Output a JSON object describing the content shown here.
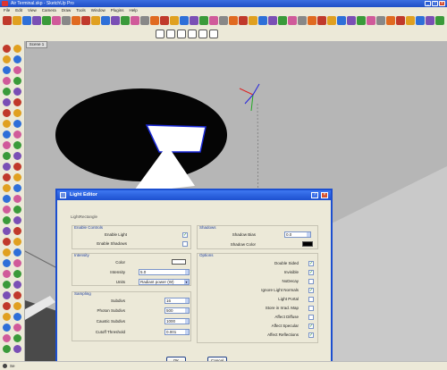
{
  "window": {
    "title": "Air Terminal.skp - SketchUp Pro",
    "minimize": "_",
    "maximize": "□",
    "close": "×"
  },
  "menu": [
    "File",
    "Edit",
    "View",
    "Camera",
    "Draw",
    "Tools",
    "Window",
    "Plugins",
    "Help"
  ],
  "scene": {
    "tab_label": "Scene 1"
  },
  "dialog": {
    "title": "Light Editor",
    "help_label": "?",
    "close_label": "×",
    "section_title": "LightRectangle",
    "groups": {
      "enable_controls": "Enable Controls",
      "intensity": "Intensity",
      "sampling": "Sampling",
      "shadows": "Shadows",
      "options": "Options"
    },
    "enable": {
      "enable_light": {
        "label": "Enable Light",
        "checked": true
      },
      "enable_shadows": {
        "label": "Enable Shadows",
        "checked": false
      }
    },
    "intensity": {
      "color_label": "Color",
      "color_value": "#ffffff",
      "intensity_label": "Intensity",
      "intensity_value": "5.0",
      "units_label": "Units",
      "units_value": "Radiant power (W)"
    },
    "sampling": {
      "subdivs_label": "Subdivs",
      "subdivs_value": "16",
      "photon_label": "Photon Subdivs",
      "photon_value": "500",
      "caustic_label": "Caustic Subdivs",
      "caustic_value": "1000",
      "cutoff_label": "Cutoff Threshold",
      "cutoff_value": "0.001"
    },
    "shadows": {
      "bias_label": "Shadow Bias",
      "bias_value": "0.0",
      "color_label": "Shadow Color",
      "color_value": "#000000"
    },
    "options": [
      {
        "label": "Double Sided",
        "checked": true
      },
      {
        "label": "Invisible",
        "checked": true
      },
      {
        "label": "NoDecay",
        "checked": false
      },
      {
        "label": "Ignore Light Normals",
        "checked": true
      },
      {
        "label": "Light Portal",
        "checked": false
      },
      {
        "label": "Store in Irrad. Map",
        "checked": false
      },
      {
        "label": "Affect Diffuse",
        "checked": false
      },
      {
        "label": "Affect Specular",
        "checked": true
      },
      {
        "label": "Affect Reflections",
        "checked": true
      }
    ],
    "ok_label": "OK",
    "cancel_label": "Cancel"
  },
  "status": {
    "hint": "Se"
  },
  "colors": {
    "titlebar": "#1e4ec6",
    "dialog_border": "#1c4fd0",
    "checkmark": "#218a21",
    "group_label": "#1c3d9e"
  }
}
